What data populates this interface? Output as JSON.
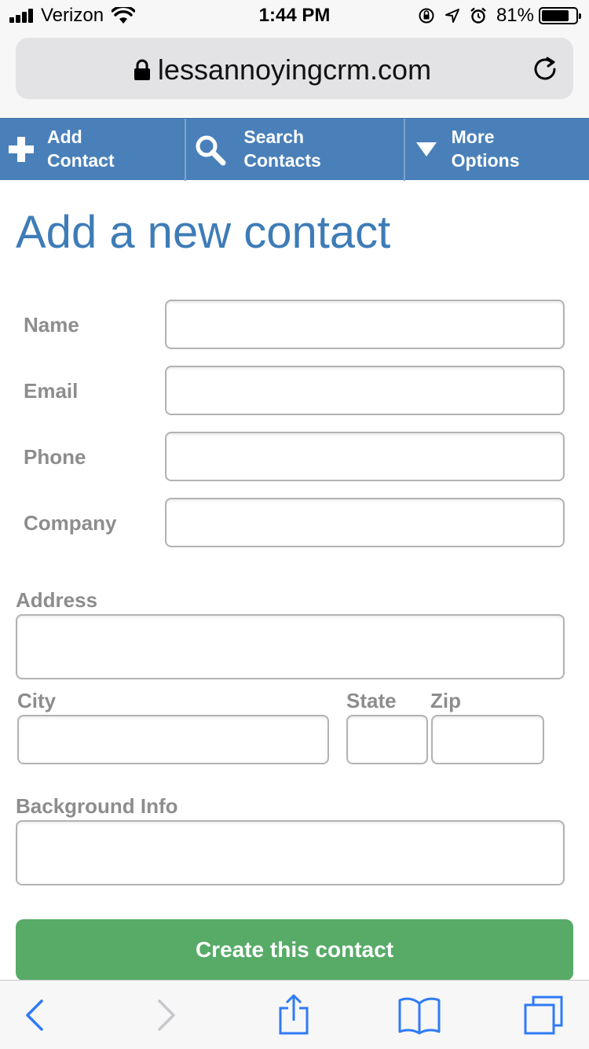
{
  "status_bar": {
    "carrier": "Verizon",
    "time": "1:44 PM",
    "battery_percent": "81%",
    "battery_level": 0.81
  },
  "browser": {
    "url": "lessannoyingcrm.com"
  },
  "nav": {
    "items": [
      {
        "line1": "Add",
        "line2": "Contact",
        "icon": "plus-icon"
      },
      {
        "line1": "Search",
        "line2": "Contacts",
        "icon": "search-icon"
      },
      {
        "line1": "More",
        "line2": "Options",
        "icon": "dropdown-triangle-icon"
      }
    ]
  },
  "page": {
    "title": "Add a new contact"
  },
  "form": {
    "name_label": "Name",
    "name_value": "",
    "email_label": "Email",
    "email_value": "",
    "phone_label": "Phone",
    "phone_value": "",
    "company_label": "Company",
    "company_value": "",
    "address_label": "Address",
    "address_value": "",
    "city_label": "City",
    "city_value": "",
    "state_label": "State",
    "state_value": "",
    "zip_label": "Zip",
    "zip_value": "",
    "background_label": "Background Info",
    "background_value": "",
    "submit_label": "Create this contact"
  },
  "toolbar": {
    "icons": [
      "back-icon",
      "forward-icon",
      "share-icon",
      "bookmarks-icon",
      "tabs-icon"
    ]
  },
  "colors": {
    "nav_bg": "#4a80b9",
    "title": "#3e7cb7",
    "button": "#57ab67",
    "label": "#8d8d8d",
    "ios_blue": "#2f7bf6"
  }
}
